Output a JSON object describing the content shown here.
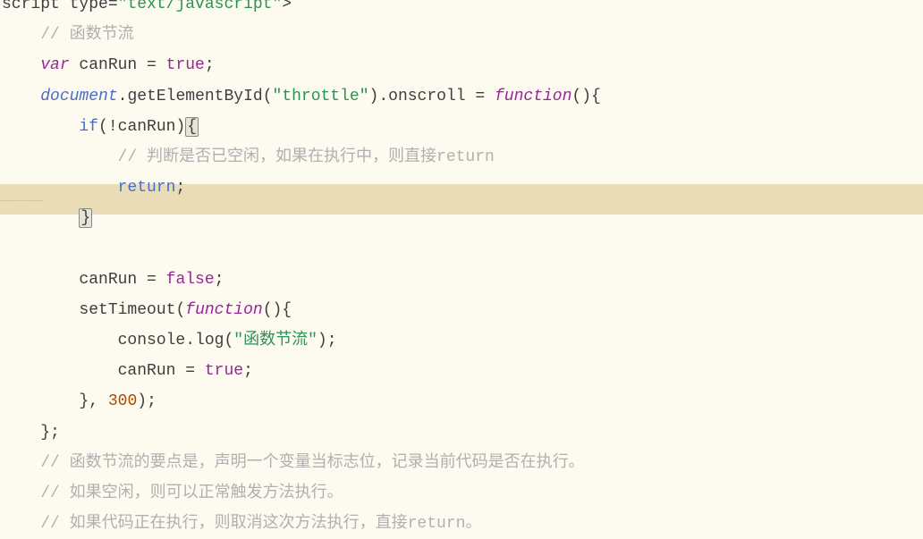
{
  "lines": {
    "l0": {
      "pre": "script type",
      "eq": "=",
      "val": "\"text/javascript\"",
      "gt": ">"
    },
    "l1_comment": "// 函数节流",
    "l2": {
      "var": "var",
      "name": " canRun ",
      "eq": "= ",
      "val": "true",
      "semi": ";"
    },
    "l3": {
      "doc": "document",
      "dot1": ".",
      "gel": "getElementById",
      "lp1": "(",
      "str": "\"throttle\"",
      "rp1": ")",
      "dot2": ".",
      "onsc": "onscroll",
      "eq": " = ",
      "fn": "function",
      "lp2": "()",
      "lb": "{"
    },
    "l4": {
      "if": "if",
      "lp": "(",
      "not": "!",
      "cr": "canRun",
      "rp": ")",
      "lb": "{"
    },
    "l5_comment": "// 判断是否已空闲，如果在执行中，则直接return",
    "l6": {
      "ret": "return",
      "semi": ";"
    },
    "l7": {
      "rb": "}"
    },
    "l8_blank": "",
    "l9": {
      "cr": "canRun",
      "eq": " = ",
      "val": "false",
      "semi": ";"
    },
    "l10": {
      "st": "setTimeout",
      "lp": "(",
      "fn": "function",
      "paren": "()",
      "lb": "{"
    },
    "l11": {
      "con": "console",
      "dot": ".",
      "log": "log",
      "lp": "(",
      "str": "\"函数节流\"",
      "rp": ")",
      "semi": ";"
    },
    "l12": {
      "cr": "canRun",
      "eq": " = ",
      "val": "true",
      "semi": ";"
    },
    "l13": {
      "rb": "}",
      "comma": ", ",
      "num": "300",
      "rp": ")",
      "semi": ";"
    },
    "l14": {
      "rb": "}",
      "semi": ";"
    },
    "l15_comment": "// 函数节流的要点是，声明一个变量当标志位，记录当前代码是否在执行。",
    "l16_comment": "// 如果空闲，则可以正常触发方法执行。",
    "l17_comment": "// 如果代码正在执行，则取消这次方法执行，直接return。"
  }
}
